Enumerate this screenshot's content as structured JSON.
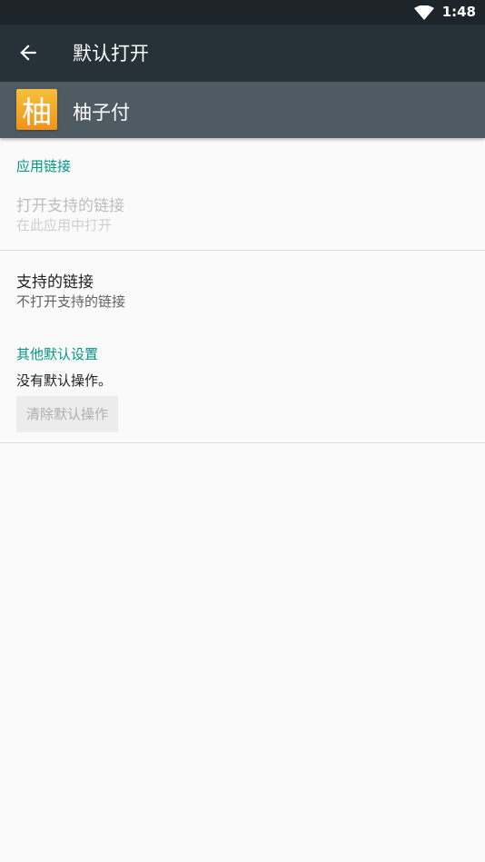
{
  "status_bar": {
    "time": "1:48",
    "wifi_icon": "wifi-icon"
  },
  "toolbar": {
    "title": "默认打开",
    "back_icon": "arrow-left-icon"
  },
  "app_header": {
    "icon_text": "柚",
    "name": "柚子付",
    "icon_colors": [
      "#f6c03a",
      "#f1921a"
    ]
  },
  "app_links": {
    "header": "应用链接",
    "open_supported": {
      "title": "打开支持的链接",
      "summary": "在此应用中打开"
    },
    "supported_links": {
      "title": "支持的链接",
      "summary": "不打开支持的链接"
    }
  },
  "other_defaults": {
    "header": "其他默认设置",
    "status": "没有默认操作。",
    "clear_button": "清除默认操作"
  },
  "colors": {
    "accent": "#009688",
    "toolbar": "#263238",
    "status_bar": "#1d252a",
    "app_header": "#4f5b62"
  }
}
